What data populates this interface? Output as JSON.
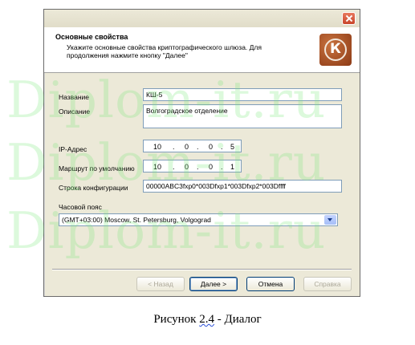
{
  "header": {
    "title": "Основные свойства",
    "description": "Укажите основные свойства криптографического шлюза. Для продолжения нажмите кнопку \"Далее\"",
    "logo_letter": "К",
    "logo_icon": "kontinent-logo-icon"
  },
  "form": {
    "name_label": "Название",
    "name_value": "КШ-5",
    "description_label": "Описание",
    "description_value": "Волгоградское отделение",
    "ip_label": "IP-Адрес",
    "ip_octets": [
      "10",
      "0",
      "0",
      "5"
    ],
    "route_label": "Маршрут по умолчанию",
    "route_octets": [
      "10",
      "0",
      "0",
      "1"
    ],
    "config_label": "Строка конфигурации",
    "config_value": "00000ABC3fxp0*003Dfxp1*003Dfxp2*003Dffff",
    "timezone_label": "Часовой пояс",
    "timezone_value": "(GMT+03:00) Moscow, St. Petersburg, Volgograd"
  },
  "buttons": {
    "back": "< Назад",
    "next": "Далее >",
    "cancel": "Отмена",
    "help": "Справка"
  },
  "watermark": [
    "Diplom-it.ru",
    "Diplom-it.ru",
    "Diplom-it.ru"
  ],
  "caption": {
    "prefix": "Рисунок ",
    "number": "2.4",
    "suffix": "  - Диалог"
  },
  "colors": {
    "accent": "#003c74",
    "watermark": "#78e678",
    "logo": "#a84d22"
  }
}
